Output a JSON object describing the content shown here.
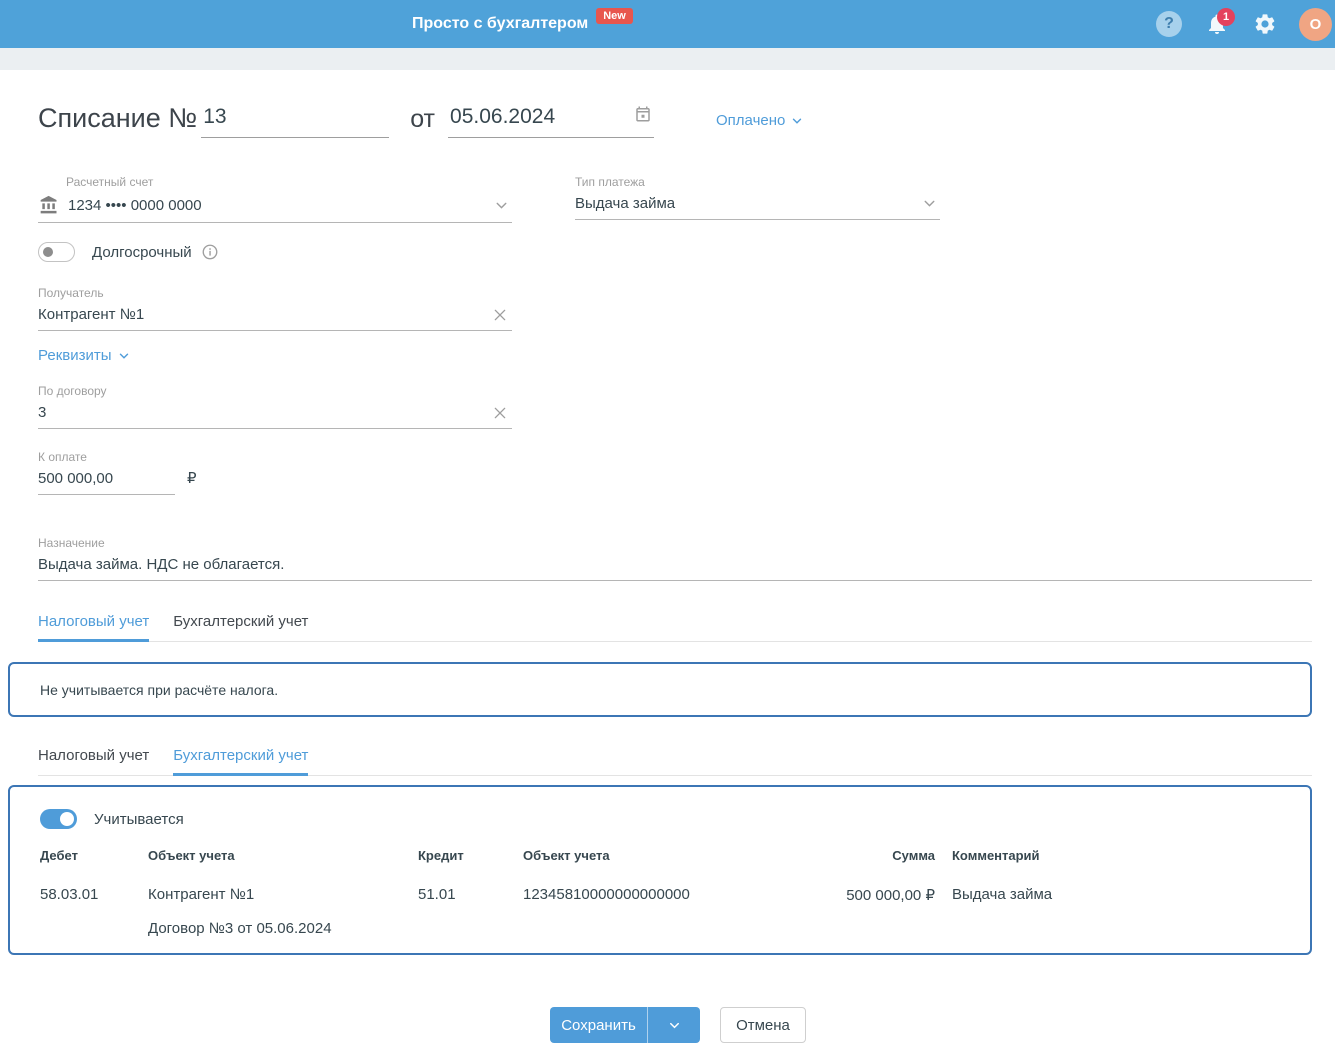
{
  "colors": {
    "header_bg": "#4fa2d9",
    "accent_blue": "#4f9cd9",
    "box_border": "#3c76b5",
    "new_badge_red": "#e8564e",
    "notification_red": "#e4425d",
    "avatar_orange": "#f0a583"
  },
  "header": {
    "app_title": "Просто с бухгалтером",
    "new_badge": "New",
    "help_glyph": "?",
    "notification_count": "1",
    "avatar_initial": "О"
  },
  "document": {
    "title": "Списание №",
    "number": "13",
    "date_preposition": "от",
    "date": "05.06.2024",
    "status": "Оплачено"
  },
  "form": {
    "account_label": "Расчетный счет",
    "account_value": "1234 •••• 0000 0000",
    "payment_type_label": "Тип платежа",
    "payment_type_value": "Выдача займа",
    "long_term_label": "Долгосрочный",
    "recipient_label": "Получатель",
    "recipient_value": "Контрагент №1",
    "details_link": "Реквизиты",
    "contract_label": "По договору",
    "contract_value": "3",
    "amount_label": "К оплате",
    "amount_value": "500 000,00",
    "currency": "₽",
    "purpose_label": "Назначение",
    "purpose_value": "Выдача займа. НДС не облагается."
  },
  "tax_section": {
    "tabs": [
      "Налоговый учет",
      "Бухгалтерский учет"
    ],
    "note": "Не учитывается при расчёте налога."
  },
  "accounting_section": {
    "tabs": [
      "Налоговый учет",
      "Бухгалтерский учет"
    ],
    "toggle_label": "Учитывается",
    "table": {
      "headers": [
        "Дебет",
        "Объект учета",
        "Кредит",
        "Объект учета",
        "Сумма",
        "Комментарий"
      ],
      "row": {
        "debit_account": "58.03.01",
        "debit_object": "Контрагент №1",
        "debit_object_line2": "Договор №3 от 05.06.2024",
        "credit_account": "51.01",
        "credit_object": "12345810000000000000",
        "amount": "500 000,00 ₽",
        "comment": "Выдача займа"
      }
    }
  },
  "actions": {
    "save": "Сохранить",
    "cancel": "Отмена"
  }
}
